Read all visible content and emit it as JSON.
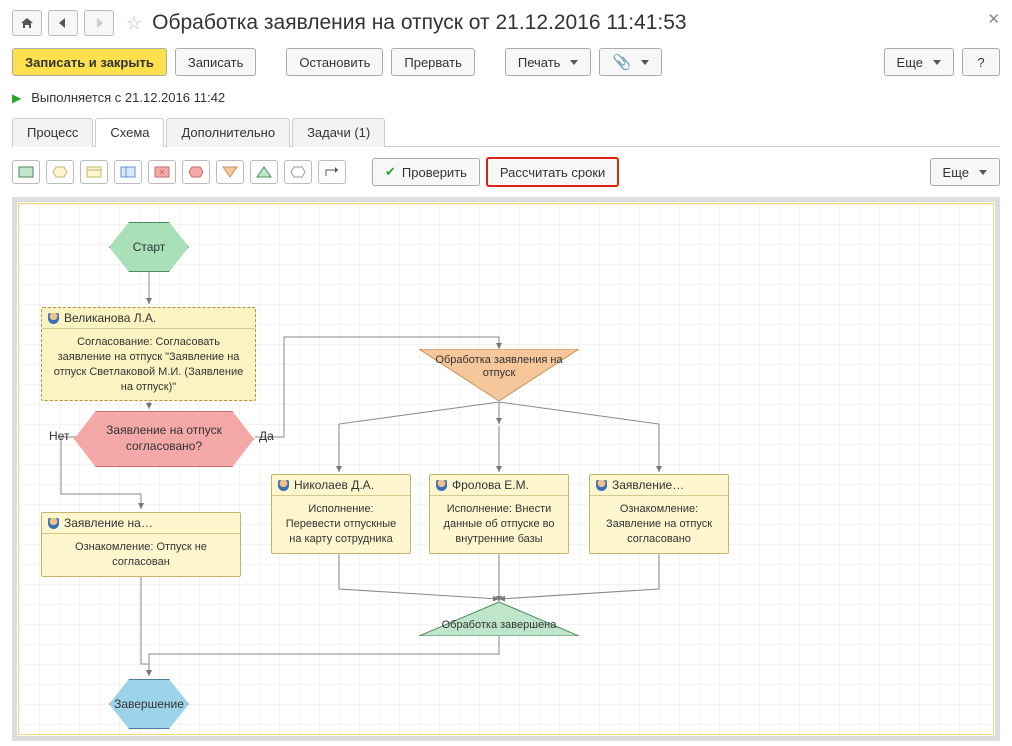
{
  "title": "Обработка заявления на отпуск от 21.12.2016 11:41:53",
  "toolbar": {
    "save_close": "Записать и закрыть",
    "save": "Записать",
    "stop": "Остановить",
    "abort": "Прервать",
    "print": "Печать",
    "more": "Еще",
    "help": "?"
  },
  "status": "Выполняется с 21.12.2016 11:42",
  "tabs": {
    "process": "Процесс",
    "scheme": "Схема",
    "extra": "Дополнительно",
    "tasks": "Задачи (1)"
  },
  "subtoolbar": {
    "check": "Проверить",
    "calc": "Рассчитать сроки",
    "more": "Еще"
  },
  "nodes": {
    "start": "Старт",
    "approver_name": "Великанова Л.А.",
    "approver_body": "Согласование: Согласовать заявление на отпуск \"Заявление на отпуск Светлаковой М.И. (Заявление на отпуск)\"",
    "decision": "Заявление на отпуск согласовано?",
    "no": "Нет",
    "yes": "Да",
    "reject_head": "Заявление  на…",
    "reject_body": "Ознакомление: Отпуск не согласован",
    "split_label": "Обработка заявления на отпуск",
    "t1_head": "Николаев Д.А.",
    "t1_body": "Исполнение: Перевести отпускные на карту сотрудника",
    "t2_head": "Фролова Е.М.",
    "t2_body": "Исполнение: Внести данные об отпуске во внутренние базы",
    "t3_head": "Заявление…",
    "t3_body": "Ознакомление: Заявление на отпуск согласовано",
    "join_label": "Обработка завершена",
    "end": "Завершение"
  }
}
